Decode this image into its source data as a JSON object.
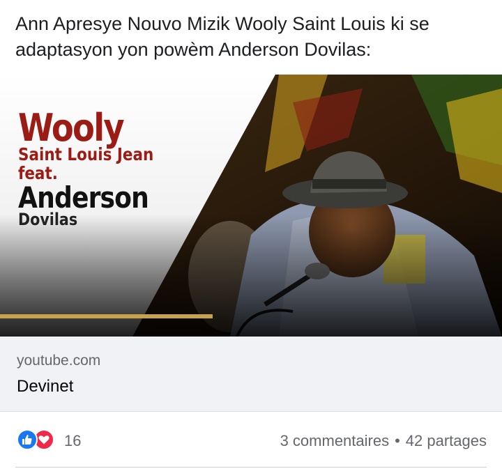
{
  "post": {
    "text": "Ann Apresye Nouvo Mizik Wooly Saint Louis ki se adaptasyon yon powèm Anderson Dovilas:"
  },
  "thumbnail": {
    "line1": "Wooly",
    "line2": "Saint Louis Jean",
    "line3": "feat.",
    "line4": "Anderson",
    "line5": "Dovilas"
  },
  "link": {
    "domain": "youtube.com",
    "title": "Devinet"
  },
  "reactions": {
    "icons": [
      "like-icon",
      "love-icon"
    ],
    "count": "16",
    "comments": "3 commentaires",
    "separator": "•",
    "shares": "42 partages"
  },
  "colors": {
    "like": "#1a77f2",
    "love": "#f0284a",
    "title_red": "#9b1c14",
    "gold_bar": "#c8a24a",
    "meta_bg": "#f0f2f5"
  }
}
